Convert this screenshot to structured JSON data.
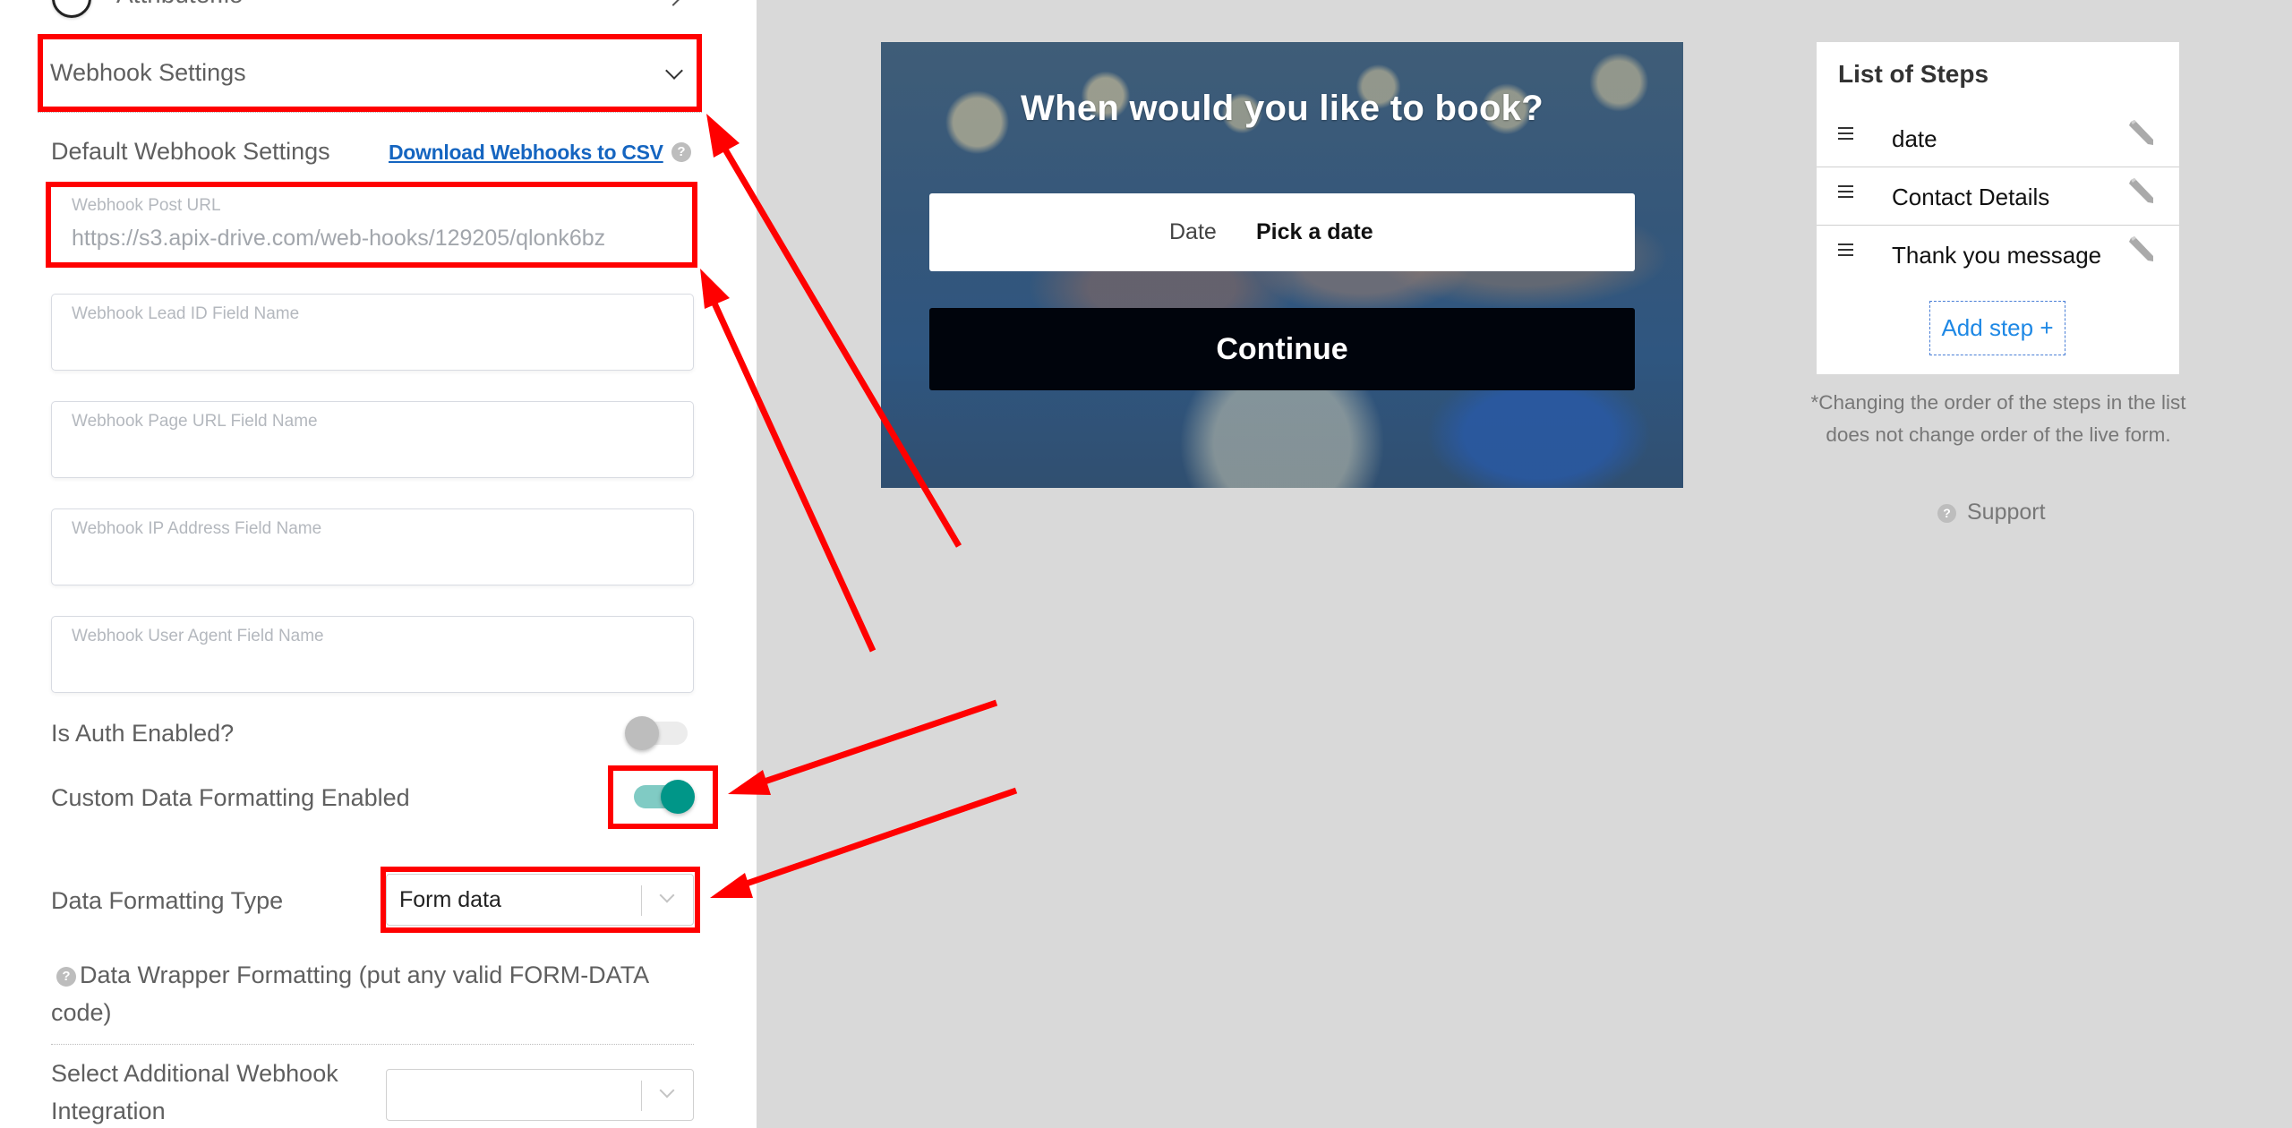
{
  "left_panel": {
    "integration_row": {
      "label": "Attributer.io",
      "icon": "attributer-logo-icon",
      "chevron": "chevron-right-icon"
    },
    "section": {
      "title": "Webhook Settings",
      "chevron": "chevron-down-icon",
      "expanded": true
    },
    "subheader": "Default Webhook Settings",
    "download_link": "Download Webhooks to CSV",
    "help_glyph": "?",
    "fields": [
      {
        "label": "Webhook Post URL",
        "value": "https://s3.apix-drive.com/web-hooks/129205/qlonk6bz"
      },
      {
        "label": "Webhook Lead ID Field Name",
        "value": ""
      },
      {
        "label": "Webhook Page URL Field Name",
        "value": ""
      },
      {
        "label": "Webhook IP Address Field Name",
        "value": ""
      },
      {
        "label": "Webhook User Agent Field Name",
        "value": ""
      }
    ],
    "auth": {
      "label": "Is Auth Enabled?",
      "enabled": false
    },
    "custom_formatting": {
      "label": "Custom Data Formatting Enabled",
      "enabled": true
    },
    "formatting_type": {
      "label": "Data Formatting Type",
      "selected": "Form data"
    },
    "wrapper_label": "Data Wrapper Formatting (put any valid FORM-DATA code)",
    "additional_integration": {
      "label": "Select Additional Webhook Integration",
      "selected": ""
    }
  },
  "preview": {
    "title": "When would you like to book?",
    "date_label": "Date",
    "date_placeholder": "Pick a date",
    "continue_label": "Continue"
  },
  "steps_panel": {
    "title": "List of Steps",
    "steps": [
      {
        "label": "date"
      },
      {
        "label": "Contact Details"
      },
      {
        "label": "Thank you message"
      }
    ],
    "add_step_label": "Add step +",
    "note": "*Changing the order of the steps in the list does not change order of the live form.",
    "support_label": "Support"
  },
  "colors": {
    "annotation_red": "#ff0000",
    "toggle_on": "#009688",
    "toggle_on_track": "#80cbc4",
    "link_blue": "#1565c0",
    "add_step_blue": "#1e88e5",
    "continue_bg": "#00040c"
  }
}
